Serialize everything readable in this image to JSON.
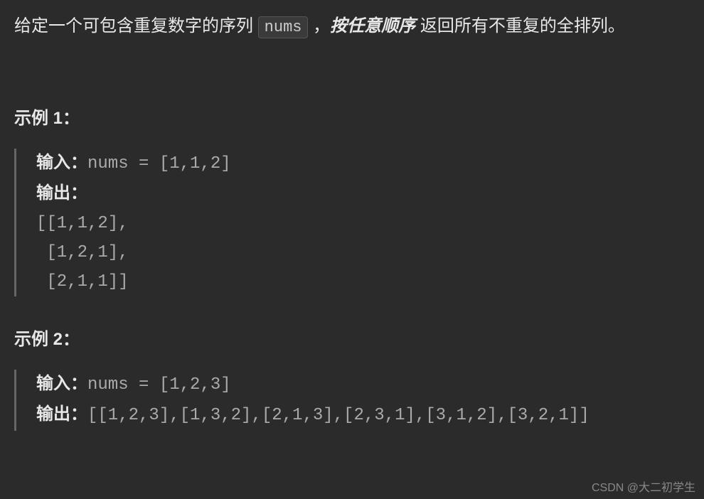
{
  "description": {
    "prefix": "给定一个可包含重复数字的序列 ",
    "code": "nums",
    "middle1": " ，",
    "emphasis": "按任意顺序",
    "suffix": " 返回所有不重复的全排列。"
  },
  "example1": {
    "heading": "示例 1：",
    "input_label": "输入：",
    "input_value": "nums = [1,1,2]",
    "output_label": "输出：",
    "output_lines": "[[1,1,2],\n [1,2,1],\n [2,1,1]]"
  },
  "example2": {
    "heading": "示例 2：",
    "input_label": "输入：",
    "input_value": "nums = [1,2,3]",
    "output_label": "输出：",
    "output_value": "[[1,2,3],[1,3,2],[2,1,3],[2,3,1],[3,1,2],[3,2,1]]"
  },
  "watermark": "CSDN @大二初学生"
}
